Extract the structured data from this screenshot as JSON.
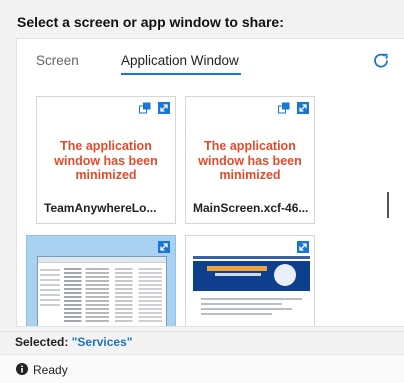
{
  "dialog": {
    "heading": "Select a screen or app window to share:"
  },
  "tabs": [
    {
      "label": "Screen",
      "active": false
    },
    {
      "label": "Application Window",
      "active": true
    }
  ],
  "refresh_icon": "refresh-icon",
  "windows": [
    {
      "title": "TeamAnywhereLo...",
      "message": "The application window has been minimized",
      "icons": [
        "restore-icon",
        "expand-icon"
      ]
    },
    {
      "title": "MainScreen.xcf-46...",
      "message": "The application window has been minimized",
      "icons": [
        "restore-icon",
        "expand-icon"
      ]
    },
    {
      "title": "",
      "selected": true,
      "icons": [
        "expand-icon"
      ]
    },
    {
      "title": "",
      "icons": [
        "expand-icon"
      ]
    }
  ],
  "selection": {
    "label": "Selected:",
    "value": "\"Services\""
  },
  "status": {
    "text": "Ready",
    "icon": "info-icon"
  },
  "colors": {
    "accent": "#1976d2",
    "minimized_text": "#e04b2b",
    "selected_thumb": "#a9d1f2",
    "selected_value": "#1d72b8"
  }
}
